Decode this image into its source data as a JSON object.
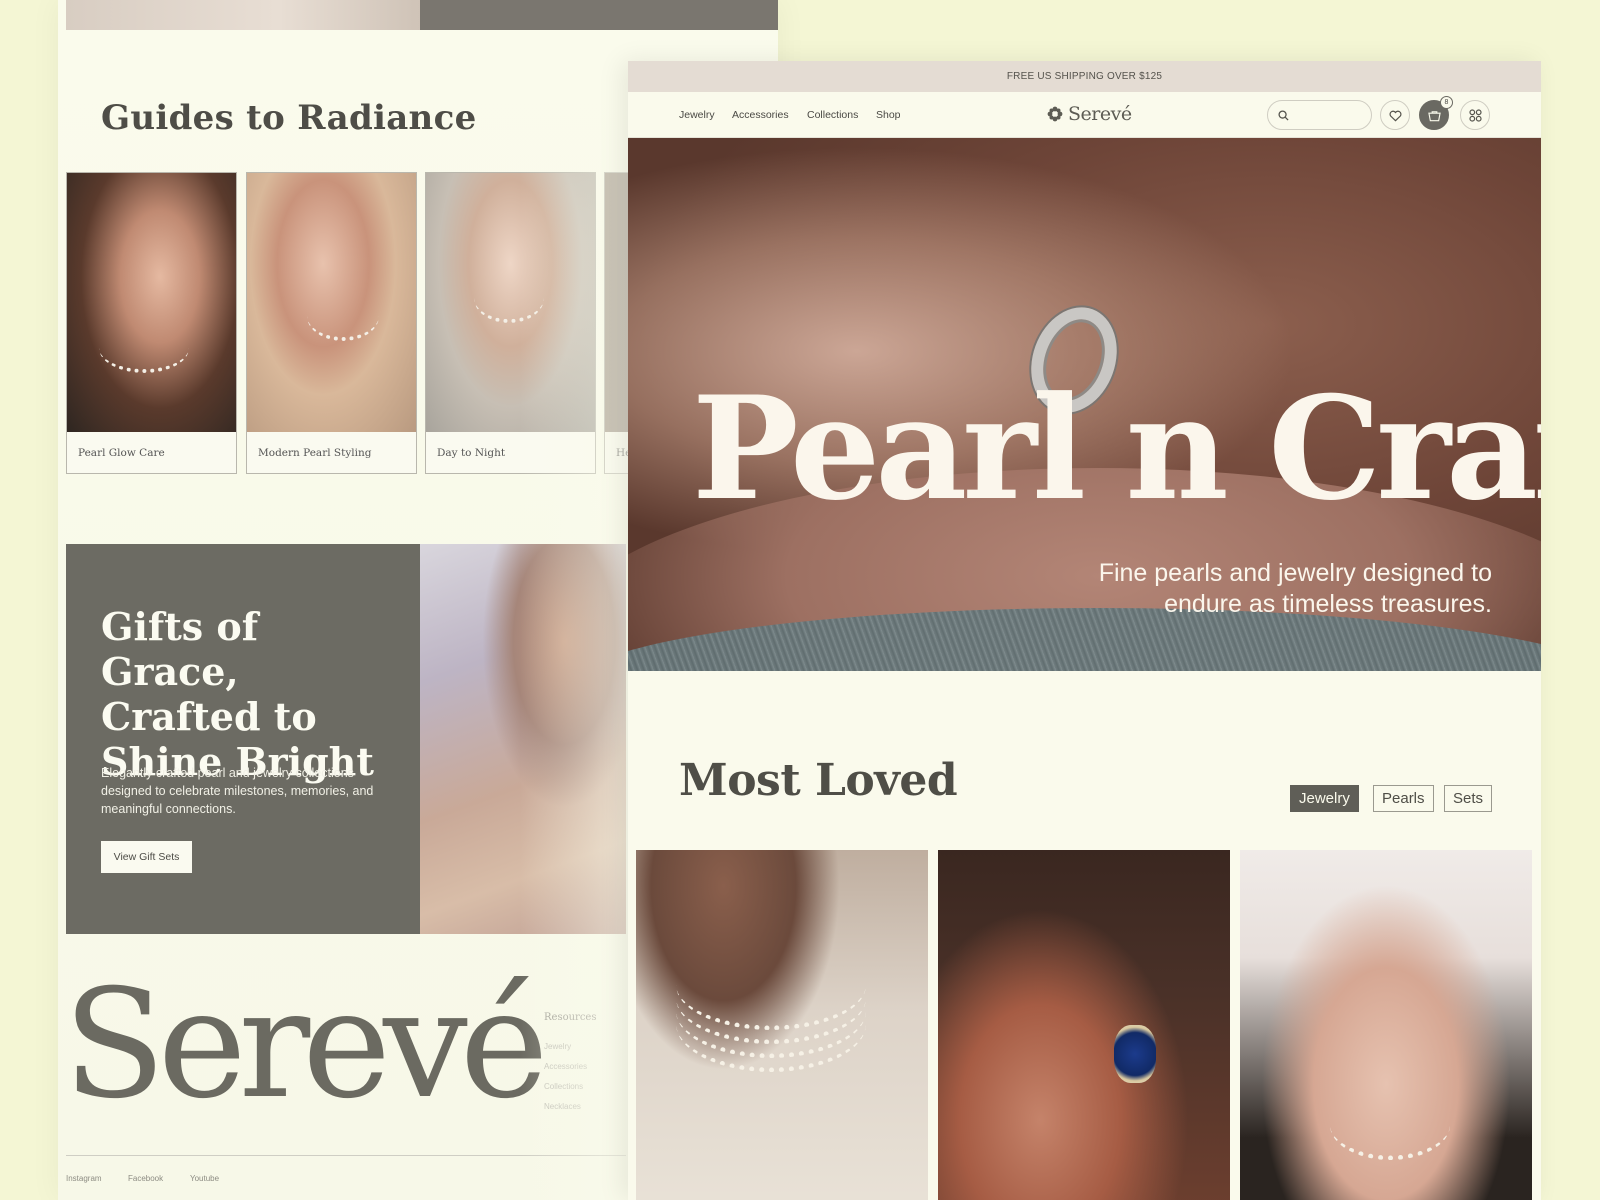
{
  "back_page": {
    "guides": {
      "title": "Guides to Radiance",
      "cards": [
        {
          "caption": "Pearl Glow Care"
        },
        {
          "caption": "Modern Pearl Styling"
        },
        {
          "caption": "Day to Night"
        },
        {
          "caption": "He"
        }
      ]
    },
    "gifts": {
      "title": "Gifts of Grace, Crafted to Shine Bright",
      "text": "Elegantly crafted pearl and jewelry collections designed to celebrate milestones, memories, and meaningful connections.",
      "button_label": "View Gift Sets"
    },
    "footer": {
      "logo": "Serevé",
      "resources_heading": "Resources",
      "resources": [
        "Jewelry",
        "Accessories",
        "Collections",
        "Necklaces"
      ],
      "social": [
        "Instagram",
        "Facebook",
        "Youtube"
      ]
    }
  },
  "front_page": {
    "shipping_banner": "FREE US SHIPPING OVER $125",
    "nav": {
      "links": [
        "Jewelry",
        "Accessories",
        "Collections",
        "Shop"
      ],
      "brand": "Serevé",
      "cart_count": "8",
      "icons": [
        "search-icon",
        "heart-icon",
        "cart-icon",
        "grid-icon"
      ]
    },
    "hero": {
      "title": "Pearl n Craft",
      "subtitle": "Fine pearls and jewelry designed to endure as timeless treasures."
    },
    "most_loved": {
      "title": "Most Loved",
      "filters": [
        "Jewelry",
        "Pearls",
        "Sets"
      ],
      "active_filter": "Jewelry"
    }
  },
  "colors": {
    "background": "#f4f6d4",
    "page": "#fafaec",
    "accent_dark": "#6c6b63",
    "banner": "#e4dcd3"
  }
}
